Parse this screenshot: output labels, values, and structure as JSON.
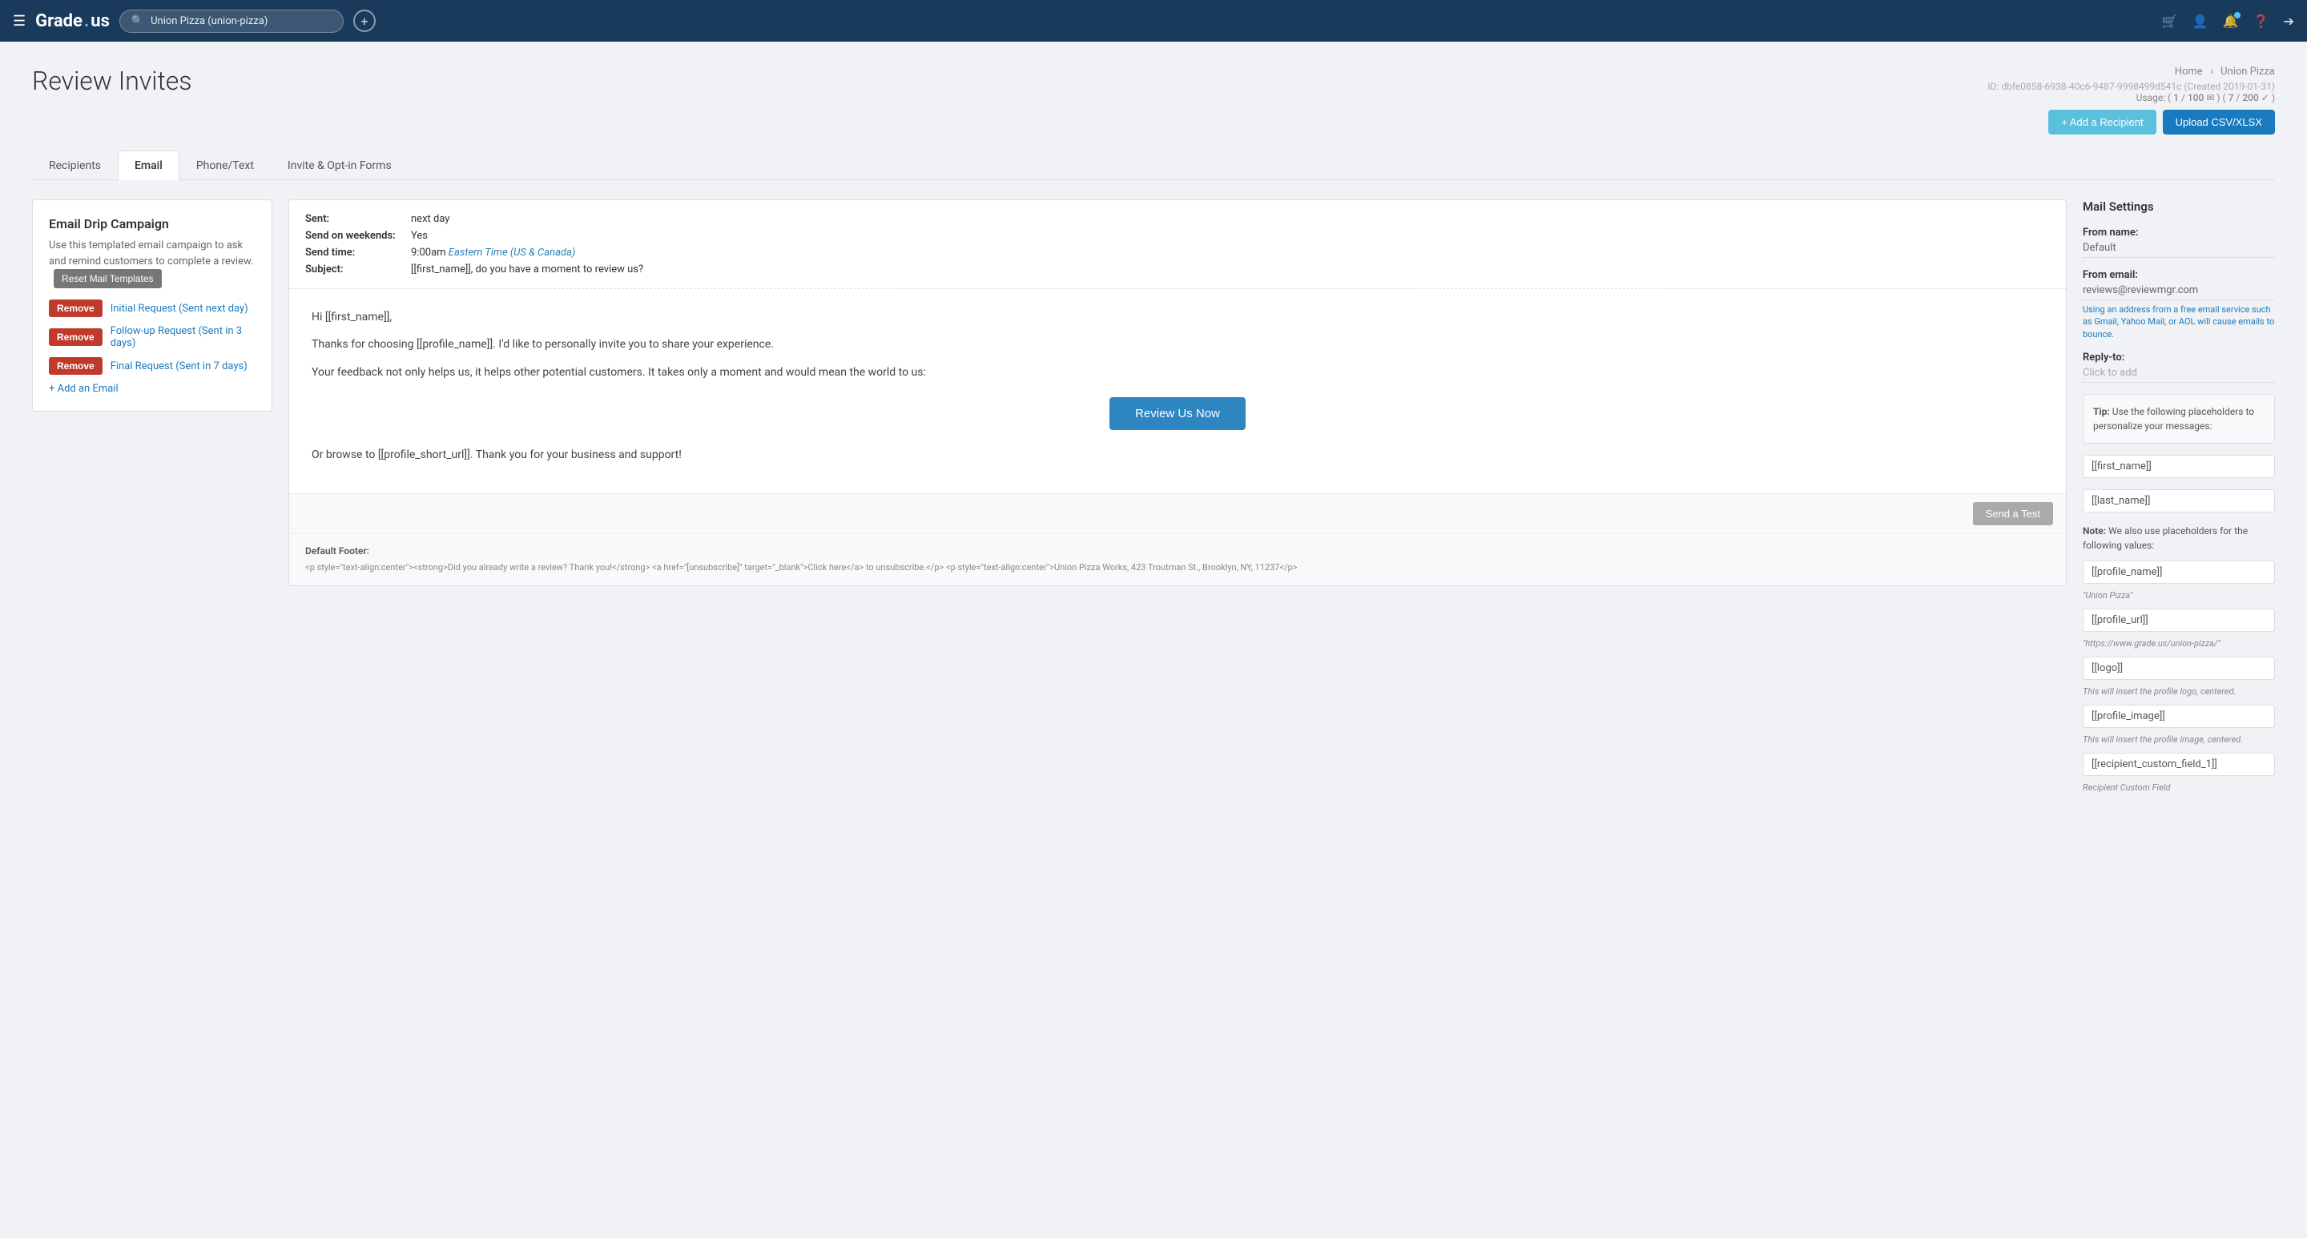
{
  "topnav": {
    "logo": "Grade.us",
    "search_placeholder": "Union Pizza (union-pizza)",
    "icons": [
      "bag-icon",
      "user-icon",
      "bell-icon",
      "question-icon",
      "logout-icon"
    ]
  },
  "breadcrumb": {
    "home": "Home",
    "location": "Union Pizza"
  },
  "page": {
    "title": "Review Invites",
    "id": "ID: dbfe0858-6938-40c6-9487-9998499d541c (Created 2019-01-31)"
  },
  "usage": {
    "label": "Usage:",
    "email_used": "1",
    "email_total": "100",
    "sms_used": "7",
    "sms_total": "200"
  },
  "action_buttons": {
    "add_recipient": "+ Add a Recipient",
    "upload_csv": "Upload CSV/XLSX"
  },
  "tabs": [
    {
      "label": "Recipients",
      "active": false
    },
    {
      "label": "Email",
      "active": true
    },
    {
      "label": "Phone/Text",
      "active": false
    },
    {
      "label": "Invite & Opt-in Forms",
      "active": false
    }
  ],
  "email_drip": {
    "title": "Email Drip Campaign",
    "description": "Use this templated email campaign to ask and remind customers to complete a review.",
    "reset_btn": "Reset Mail Templates",
    "emails": [
      {
        "label": "Initial Request (Sent next day)",
        "remove": "Remove"
      },
      {
        "label": "Follow-up Request (Sent in 3 days)",
        "remove": "Remove"
      },
      {
        "label": "Final Request (Sent in 7 days)",
        "remove": "Remove"
      }
    ],
    "add_email": "+ Add an Email"
  },
  "email_preview": {
    "sent_label": "Sent:",
    "sent_value": "next day",
    "weekends_label": "Send on weekends:",
    "weekends_value": "Yes",
    "time_label": "Send time:",
    "time_value": "9:00am",
    "time_tz": "Eastern Time (US & Canada)",
    "subject_label": "Subject:",
    "subject_value": "[[first_name]], do you have a moment to review us?",
    "body_greeting": "Hi [[first_name]],",
    "body_p1": "Thanks for choosing [[profile_name]]. I'd like to personally invite you to share your experience.",
    "body_p2": "Your feedback not only helps us, it helps other potential customers. It takes only a moment and would mean the world to us:",
    "review_btn": "Review Us Now",
    "body_browse": "Or browse to [[profile_short_url]]. Thank you for your business and support!",
    "send_test_btn": "Send a Test",
    "footer_label": "Default Footer:",
    "footer_content": "<p style=\"text-align:center\"><strong>Did you already write a review? Thank you!</strong> <a href=\"[unsubscribe]\" target=\"_blank\">Click here</a> to unsubscribe.</p> <p style=\"text-align:center\">Union Pizza Works, 423 Troutman St., Brooklyn, NY, 11237</p>"
  },
  "mail_settings": {
    "title": "Mail Settings",
    "from_name_label": "From name:",
    "from_name_value": "Default",
    "from_email_label": "From email:",
    "from_email_value": "reviews@reviewmgr.com",
    "from_email_note": "Using an address from a free email service such as Gmail, Yahoo Mail, or AOL will cause emails to bounce.",
    "reply_to_label": "Reply-to:",
    "reply_to_placeholder": "Click to add",
    "tip_label": "Tip:",
    "tip_text": "Use the following placeholders to personalize your messages:",
    "placeholders_basic": [
      "[[first_name]]",
      "[[last_name]]"
    ],
    "note_label": "Note:",
    "note_text": "We also use placeholders for the following values:",
    "placeholders_advanced": [
      {
        "tag": "[[profile_name]]",
        "desc": "\"Union Pizza\""
      },
      {
        "tag": "[[profile_url]]",
        "desc": "\"https://www.grade.us/union-pizza/\""
      },
      {
        "tag": "[[logo]]",
        "desc": "This will insert the profile logo, centered."
      },
      {
        "tag": "[[profile_image]]",
        "desc": "This will insert the profile image, centered."
      },
      {
        "tag": "[[recipient_custom_field_1]]",
        "desc": "Recipient Custom Field"
      }
    ]
  }
}
